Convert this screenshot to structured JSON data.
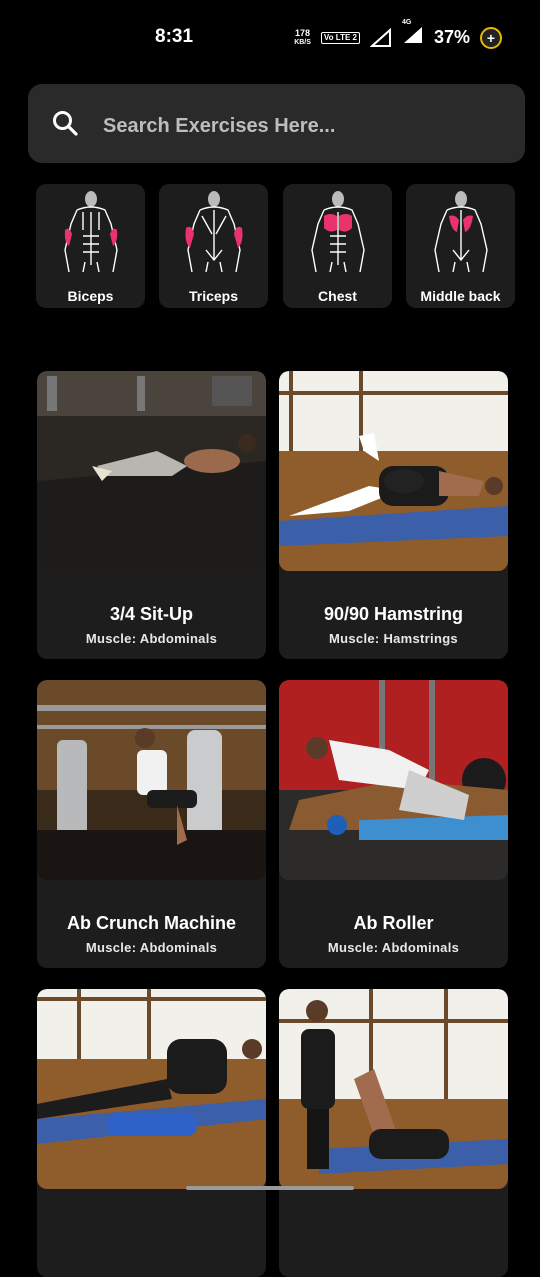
{
  "status_bar": {
    "time": "8:31",
    "speed_value": "178",
    "speed_unit": "KB/S",
    "volte": "Vo LTE 2",
    "network": "4G",
    "battery": "37%"
  },
  "search": {
    "placeholder": "Search Exercises Here...",
    "value": ""
  },
  "muscles": [
    {
      "label": "Biceps",
      "highlight": "biceps",
      "view": "front"
    },
    {
      "label": "Triceps",
      "highlight": "triceps",
      "view": "back"
    },
    {
      "label": "Chest",
      "highlight": "chest",
      "view": "front"
    },
    {
      "label": "Middle back",
      "highlight": "middle-back",
      "view": "back"
    }
  ],
  "exercises": [
    {
      "name": "3/4 Sit-Up",
      "muscle": "Muscle: Abdominals"
    },
    {
      "name": "90/90 Hamstring",
      "muscle": "Muscle: Hamstrings"
    },
    {
      "name": "Ab Crunch Machine",
      "muscle": "Muscle: Abdominals"
    },
    {
      "name": "Ab Roller",
      "muscle": "Muscle: Abdominals"
    },
    {
      "name": "",
      "muscle": ""
    },
    {
      "name": "",
      "muscle": ""
    }
  ],
  "colors": {
    "background": "#000000",
    "surface": "#1d1d1d",
    "search_surface": "#2a2a2a",
    "muscle_highlight": "#e8336d"
  }
}
